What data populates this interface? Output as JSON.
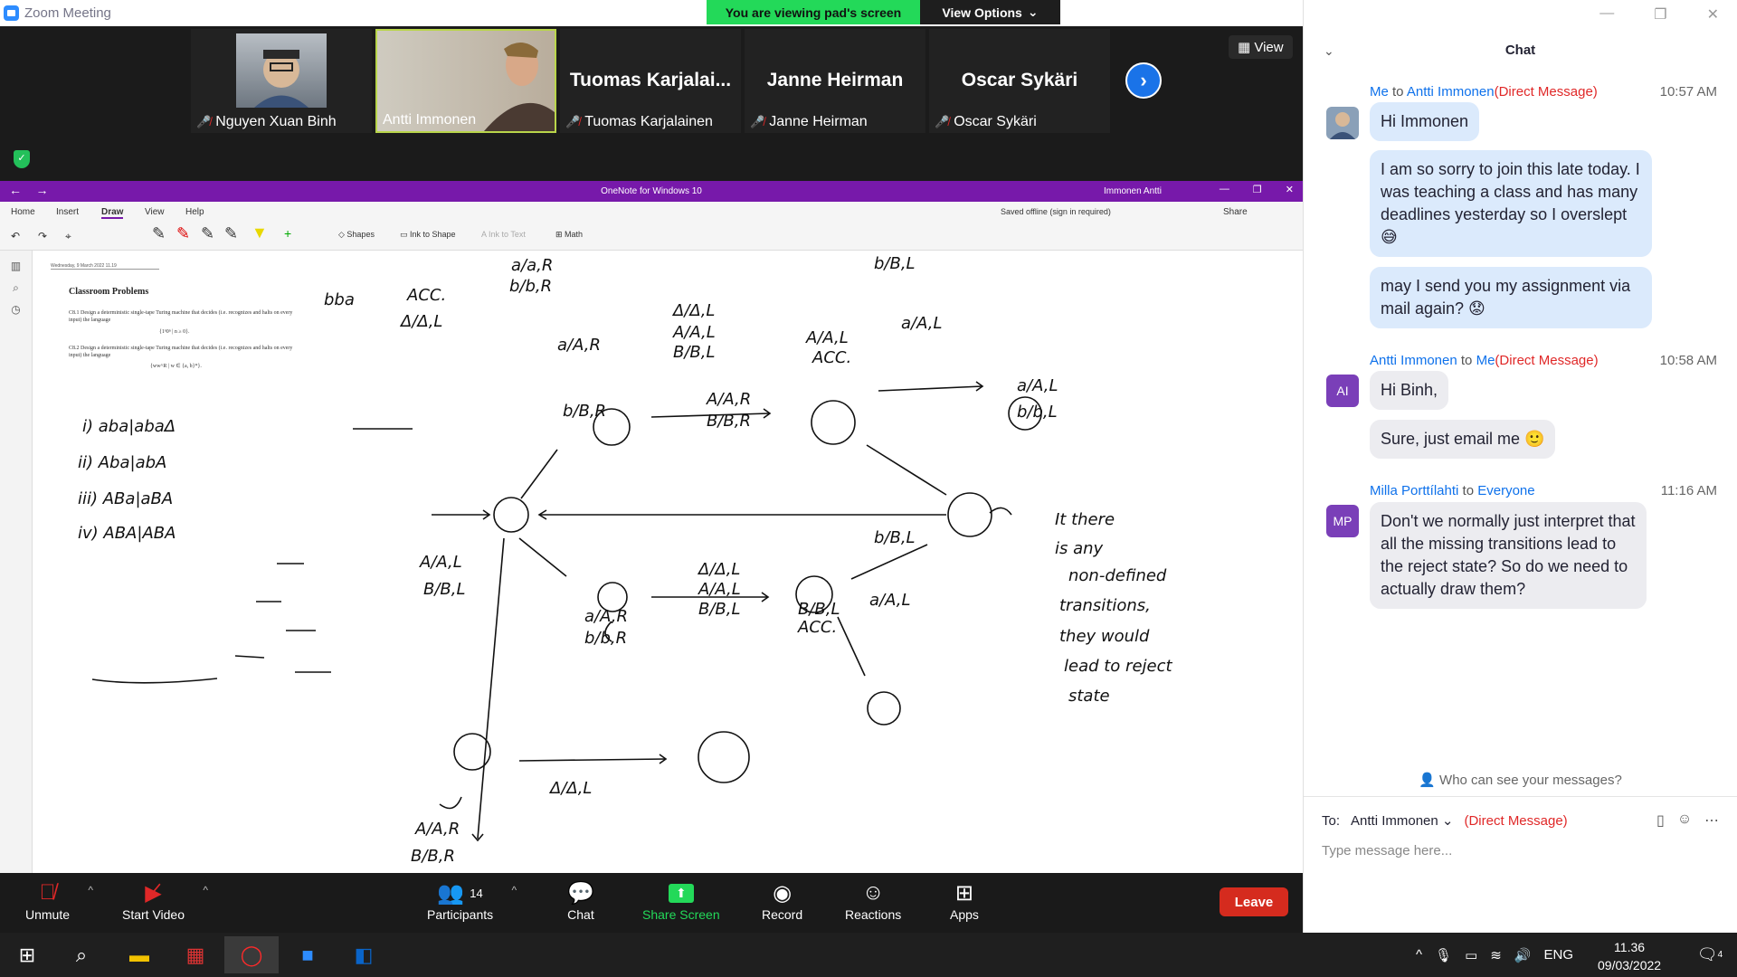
{
  "app": {
    "title": "Zoom Meeting"
  },
  "banner": {
    "viewing": "You are viewing pad's screen",
    "options": "View Options"
  },
  "gallery": {
    "view_label": "View",
    "participants": [
      {
        "name": "Nguyen Xuan Binh",
        "muted": true,
        "has_video": true
      },
      {
        "name": "Antti Immonen",
        "muted": false,
        "has_video": true,
        "speaking": true
      },
      {
        "name": "Tuomas Karjalainen",
        "display": "Tuomas  Karjalai...",
        "muted": true,
        "has_video": false
      },
      {
        "name": "Janne Heirman",
        "display": "Janne Heirman",
        "muted": true,
        "has_video": false
      },
      {
        "name": "Oscar Sykäri",
        "display": "Oscar Sykäri",
        "muted": true,
        "has_video": false
      }
    ]
  },
  "onenote": {
    "title": "OneNote for Windows 10",
    "user": "Immonen Antti",
    "menu": [
      "Home",
      "Insert",
      "Draw",
      "View",
      "Help"
    ],
    "active_menu": "Draw",
    "status": "Saved offline (sign in required)",
    "share": "Share",
    "tools": {
      "shapes": "Shapes",
      "ink_to_shape": "Ink to Shape",
      "ink_to_text": "Ink to Text",
      "math": "Math"
    },
    "page": {
      "date": "Wednesday, 9 March 2022      11.19",
      "heading": "Classroom Problems",
      "p1": "C8.1 Design a deterministic single-tape Turing machine that decides (i.e. recognizes and halts on every input) the language",
      "f1": "{1ⁿ0ⁿ | n ≥ 0}.",
      "p2": "C8.2 Design a deterministic single-tape Turing machine that decides (i.e. recognizes and halts on every input) the language",
      "f2": "{ww^R | w ∈ {a, b}*}."
    }
  },
  "toolbar": {
    "unmute": "Unmute",
    "start_video": "Start Video",
    "participants": "Participants",
    "participant_count": "14",
    "chat": "Chat",
    "share_screen": "Share Screen",
    "record": "Record",
    "reactions": "Reactions",
    "apps": "Apps",
    "leave": "Leave"
  },
  "chat": {
    "title": "Chat",
    "messages": [
      {
        "from": "Me",
        "to": "Antti Immonen",
        "dm": "(Direct Message)",
        "time": "10:57 AM",
        "texts": [
          "Hi Immonen",
          "I am so sorry to join this late today. I was teaching a class and has many deadlines yesterday so I overslept 😅",
          "may I send you my assignment via mail again? 😟"
        ]
      },
      {
        "from": "Antti Immonen",
        "initials": "AI",
        "to": "Me",
        "dm": "(Direct Message)",
        "time": "10:58 AM",
        "texts": [
          "Hi Binh,",
          "Sure, just email me 🙂"
        ]
      },
      {
        "from": "Milla Porttílahti",
        "initials": "MP",
        "to": "Everyone",
        "time": "11:16 AM",
        "texts": [
          "Don't we normally just interpret that all the missing transitions lead to the reject state? So do we need to actually draw them?"
        ]
      }
    ],
    "privacy": "Who can see your messages?",
    "to_label": "To:",
    "recipient": "Antti Immonen",
    "recipient_dm": "(Direct Message)",
    "placeholder": "Type message here..."
  },
  "taskbar": {
    "lang": "ENG",
    "time": "11.36",
    "date": "09/03/2022",
    "notifications": "4"
  },
  "colors": {
    "zoom_blue": "#2d8cff",
    "onenote_purple": "#7719aa",
    "viewing_green": "#23d959",
    "leave_red": "#d52b1e"
  }
}
